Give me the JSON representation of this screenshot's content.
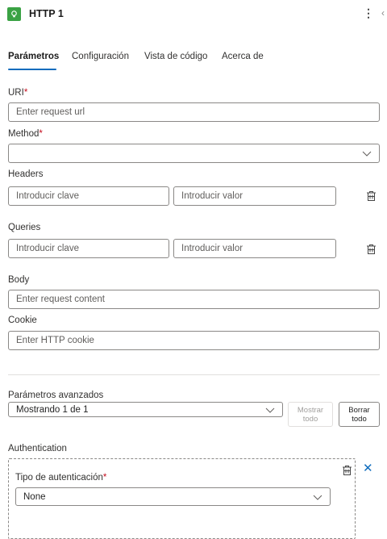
{
  "header": {
    "title": "HTTP 1",
    "icon": "lightbulb-icon",
    "more_icon": "more-vertical-icon",
    "collapse_icon": "chevron-left-icon",
    "accent": "#3aa244"
  },
  "tabs": [
    {
      "label": "Parámetros",
      "active": true
    },
    {
      "label": "Configuración",
      "active": false
    },
    {
      "label": "Vista de código",
      "active": false
    },
    {
      "label": "Acerca de",
      "active": false
    }
  ],
  "fields": {
    "uri": {
      "label": "URI",
      "required": "*",
      "placeholder": "Enter request url"
    },
    "method": {
      "label": "Method",
      "required": "*",
      "value": ""
    },
    "headers": {
      "label": "Headers",
      "key_placeholder": "Introducir clave",
      "value_placeholder": "Introducir valor"
    },
    "queries": {
      "label": "Queries",
      "key_placeholder": "Introducir clave",
      "value_placeholder": "Introducir valor"
    },
    "body": {
      "label": "Body",
      "placeholder": "Enter request content"
    },
    "cookie": {
      "label": "Cookie",
      "placeholder": "Enter HTTP cookie"
    }
  },
  "advanced": {
    "label": "Parámetros avanzados",
    "selected": "Mostrando 1 de 1",
    "show_all": "Mostrar todo",
    "clear_all": "Borrar todo"
  },
  "authentication": {
    "label": "Authentication",
    "type_label": "Tipo de autenticación",
    "required": "*",
    "type_value": "None"
  },
  "colors": {
    "accent": "#0f6cbd",
    "required": "#c50f1f"
  }
}
